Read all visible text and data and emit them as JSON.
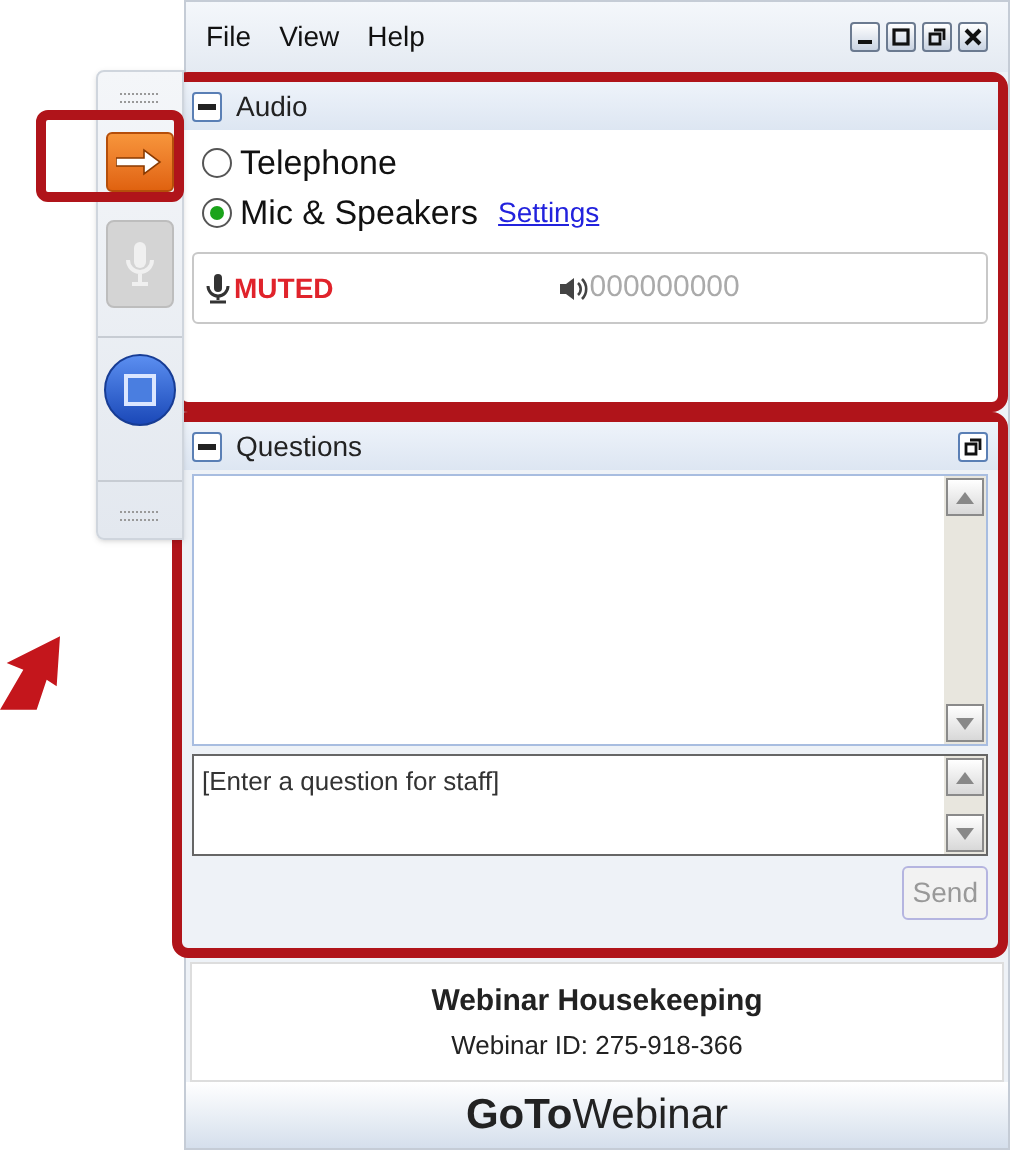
{
  "menu": [
    "File",
    "View",
    "Help"
  ],
  "audio": {
    "title": "Audio",
    "options": [
      {
        "label": "Telephone",
        "selected": false
      },
      {
        "label": "Mic & Speakers",
        "selected": true
      }
    ],
    "settings_link": "Settings",
    "mic_status": "MUTED",
    "speaker_readout": "000000000"
  },
  "questions": {
    "title": "Questions",
    "placeholder": "[Enter a question for staff]",
    "send": {
      "label": "Send",
      "disabled": true
    }
  },
  "webinar": {
    "title": "Webinar Housekeeping",
    "id_line": "Webinar ID: 275-918-366"
  },
  "logo": "**GoTo**Webinar"
}
